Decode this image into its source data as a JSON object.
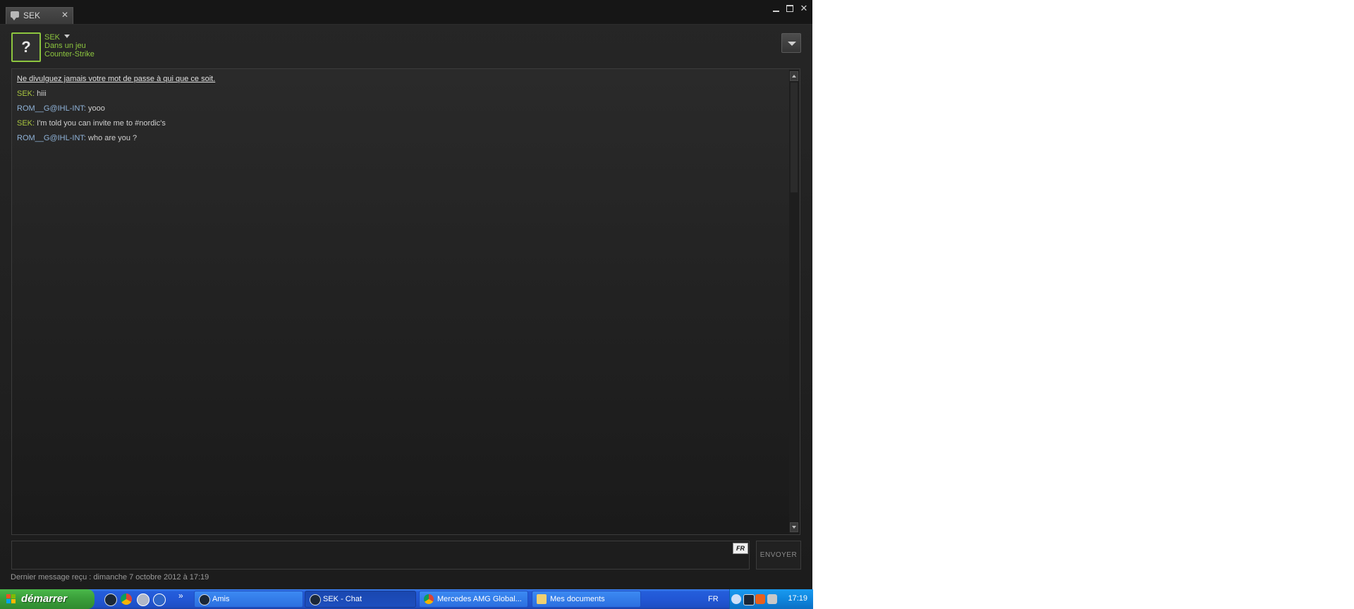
{
  "window": {
    "tab_label": "SEK",
    "tab_close": "✕",
    "close_glyph": "✕"
  },
  "friend": {
    "avatar_glyph": "?",
    "name": "SEK",
    "status": "Dans un jeu",
    "game": "Counter-Strike",
    "accent_color": "#8dc63f"
  },
  "chat": {
    "warning": "Ne divulguez jamais votre mot de passe à qui que ce soit.",
    "messages": [
      {
        "sender": "SEK:",
        "text": " hiii"
      },
      {
        "sender": "ROM__G@IHL-INT:",
        "text": " yooo"
      },
      {
        "sender": "SEK:",
        "text": " I'm told you can invite me to #nordic's"
      },
      {
        "sender": "ROM__G@IHL-INT:",
        "text": " who are you ?"
      }
    ]
  },
  "input": {
    "language_badge": "FR",
    "send_label": "ENVOYER"
  },
  "footer": {
    "last_message": "Dernier message reçu : dimanche 7 octobre 2012 à 17:19"
  },
  "taskbar": {
    "start_label": "démarrer",
    "quick_launch_more": "»",
    "tasks": [
      {
        "label": "Amis",
        "icon": "steam-icon"
      },
      {
        "label": "SEK - Chat",
        "icon": "steam-icon"
      },
      {
        "label": "Mercedes AMG Global...",
        "icon": "chrome-icon"
      },
      {
        "label": "Mes documents",
        "icon": "folder-icon"
      }
    ],
    "language": "FR",
    "clock": "17:19"
  }
}
